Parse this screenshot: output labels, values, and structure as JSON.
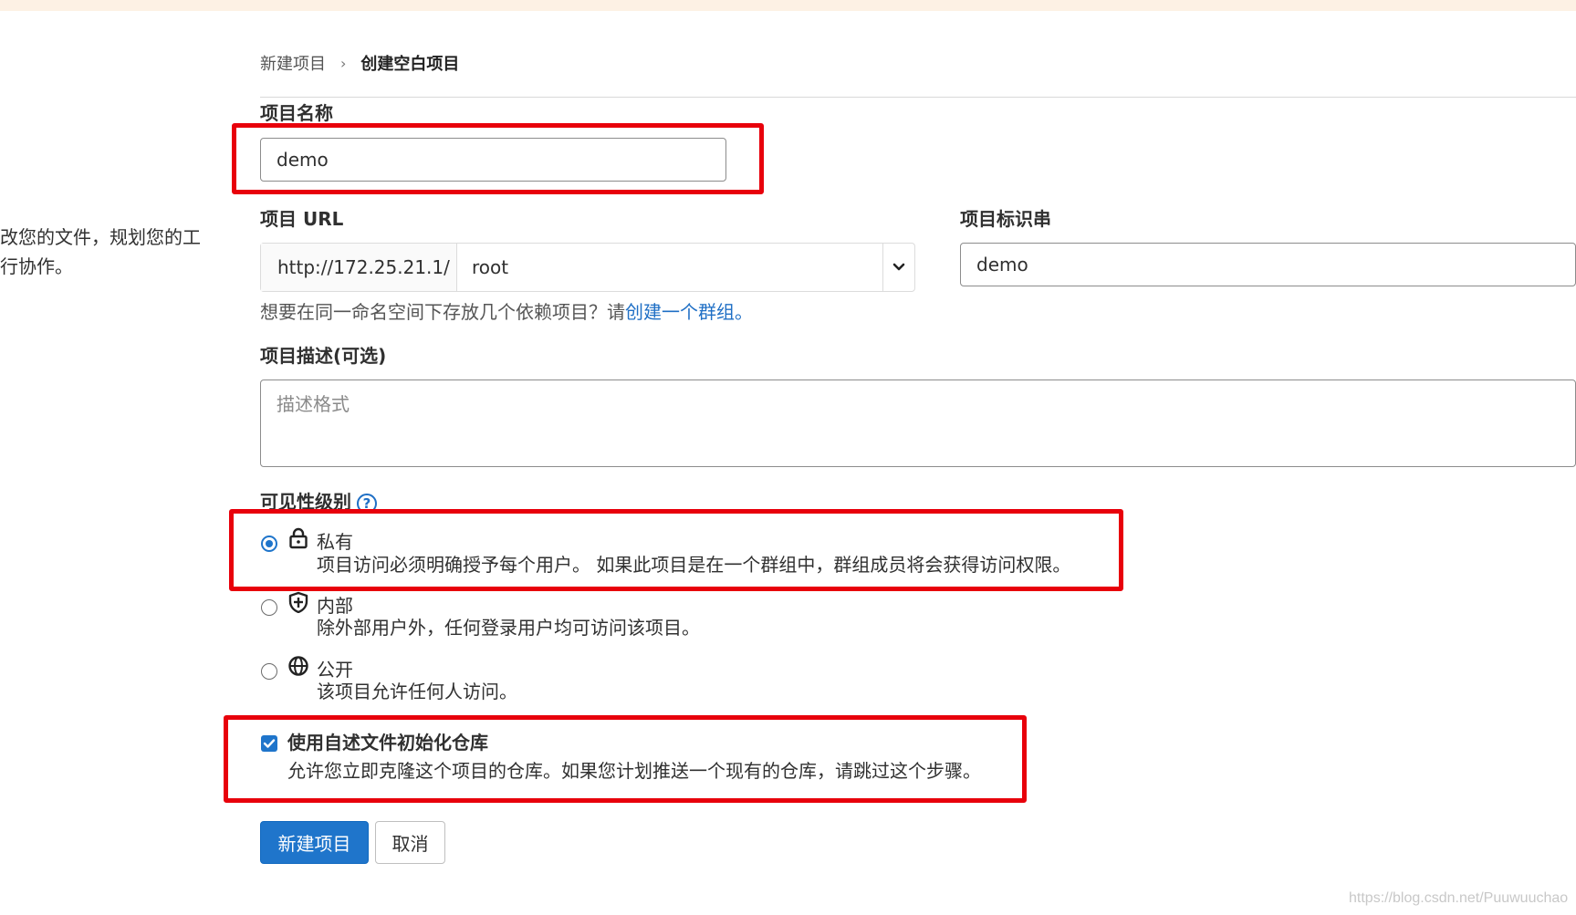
{
  "left_panel": {
    "line1": "改您的文件，规划您的工",
    "line2": "行协作。"
  },
  "breadcrumb": {
    "parent": "新建项目",
    "separator": "›",
    "current": "创建空白项目"
  },
  "form": {
    "project_name": {
      "label": "项目名称",
      "value": "demo"
    },
    "project_url": {
      "label": "项目 URL",
      "prefix": "http://172.25.21.1/",
      "namespace": "root"
    },
    "project_slug": {
      "label": "项目标识串",
      "value": "demo"
    },
    "group_hint": {
      "text": "想要在同一命名空间下存放几个依赖项目？请",
      "link": "创建一个群组。"
    },
    "description": {
      "label": "项目描述(可选)",
      "placeholder": "描述格式"
    },
    "visibility": {
      "label": "可见性级别",
      "help_icon": "question-circle-icon",
      "selected": "private",
      "options": [
        {
          "id": "private",
          "icon": "lock-icon",
          "title": "私有",
          "desc": "项目访问必须明确授予每个用户。 如果此项目是在一个群组中，群组成员将会获得访问权限。"
        },
        {
          "id": "internal",
          "icon": "shield-icon",
          "title": "内部",
          "desc": "除外部用户外，任何登录用户均可访问该项目。"
        },
        {
          "id": "public",
          "icon": "globe-icon",
          "title": "公开",
          "desc": "该项目允许任何人访问。"
        }
      ]
    },
    "init_readme": {
      "checked": true,
      "title": "使用自述文件初始化仓库",
      "desc": "允许您立即克隆这个项目的仓库。如果您计划推送一个现有的仓库，请跳过这个步骤。"
    },
    "buttons": {
      "create": "新建项目",
      "cancel": "取消"
    }
  },
  "watermark": "https://blog.csdn.net/Puuwuuchao",
  "colors": {
    "accent": "#1f75cb",
    "highlight": "#e8000b",
    "link": "#1f6fc5"
  }
}
